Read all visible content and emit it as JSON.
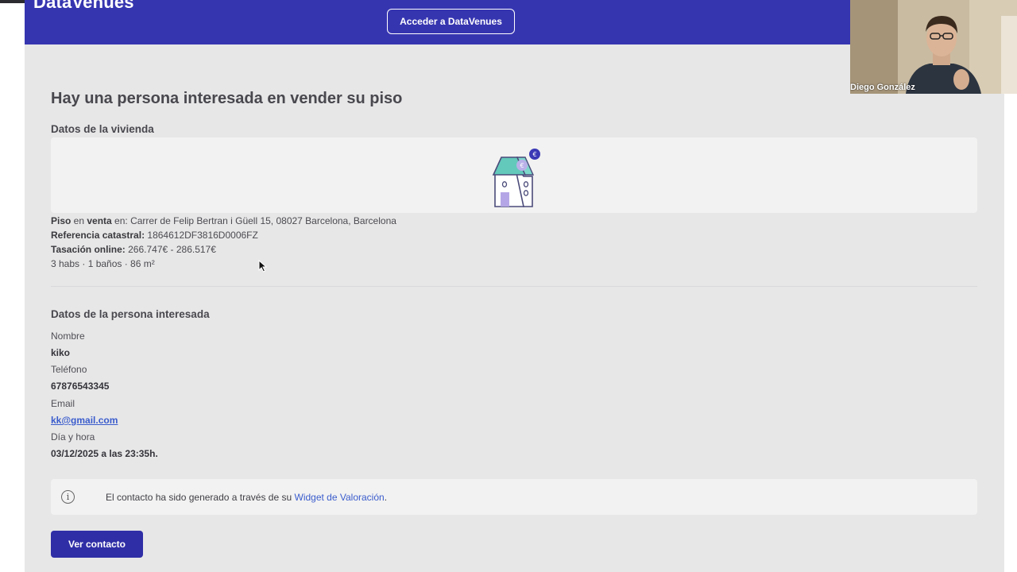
{
  "header": {
    "logo_text": "DataVenues",
    "access_button_label": "Acceder a DataVenues",
    "brand_color": "#3635b0"
  },
  "main": {
    "title": "Hay una persona interesada en vender su piso",
    "property_section": {
      "heading": "Datos de la vivienda",
      "address_type": "Piso",
      "address_middle": " en ",
      "address_status": "venta",
      "address_rest": " en: Carrer de Felip Bertran i Güell 15, 08027 Barcelona, Barcelona",
      "cadastral_label": "Referencia catastral:",
      "cadastral_value": " 1864612DF3816D0006FZ",
      "valuation_label": "Tasación online:",
      "valuation_value": " 266.747€ - 286.517€",
      "features": "3 habs · 1 baños · 86 m²"
    },
    "person_section": {
      "heading": "Datos de la persona interesada",
      "name_label": "Nombre",
      "name_value": "kiko",
      "phone_label": "Teléfono",
      "phone_value": "67876543345",
      "email_label": "Email",
      "email_value": "kk@gmail.com",
      "datetime_label": "Día y hora",
      "datetime_value": "03/12/2025 a las 23:35h."
    },
    "notice": {
      "icon": "info-icon",
      "text_prefix": "El contacto ha sido generado a través de su ",
      "link_text": "Widget de Valoración",
      "text_suffix": "."
    },
    "cta_label": "Ver contacto"
  },
  "video_overlay": {
    "participant_name": "Diego González"
  }
}
